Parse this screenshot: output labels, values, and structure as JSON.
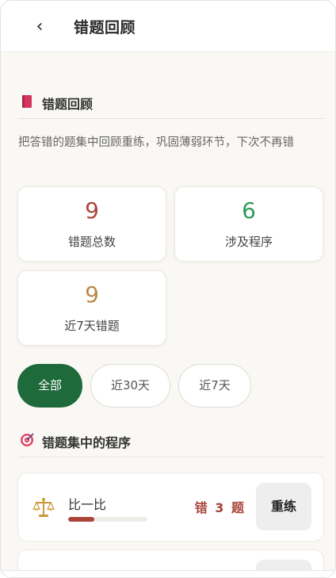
{
  "header": {
    "title": "错题回顾",
    "back_icon": "‹"
  },
  "section_review": {
    "title": "错题回顾",
    "icon": "bookmark-icon",
    "icon_color": "#d6335e"
  },
  "description": "把答错的题集中回顾重练，巩固薄弱环节，下次不再错",
  "stats": [
    {
      "value": "9",
      "label": "错题总数",
      "color": "#a9453b"
    },
    {
      "value": "6",
      "label": "涉及程序",
      "color": "#2e9a5a"
    },
    {
      "value": "9",
      "label": "近7天错题",
      "color": "#b8894a"
    }
  ],
  "filters": [
    {
      "label": "全部",
      "active": true
    },
    {
      "label": "近30天",
      "active": false
    },
    {
      "label": "近7天",
      "active": false
    }
  ],
  "section_programs": {
    "title": "错题集中的程序",
    "icon": "target-icon"
  },
  "programs": [
    {
      "name": "比一比",
      "icon": "balance-scale-icon",
      "count_text": "错 3 题",
      "progress": 0.33,
      "action": "重练"
    }
  ],
  "colors": {
    "accent": "#1e6a3a",
    "error": "#a9453b"
  }
}
